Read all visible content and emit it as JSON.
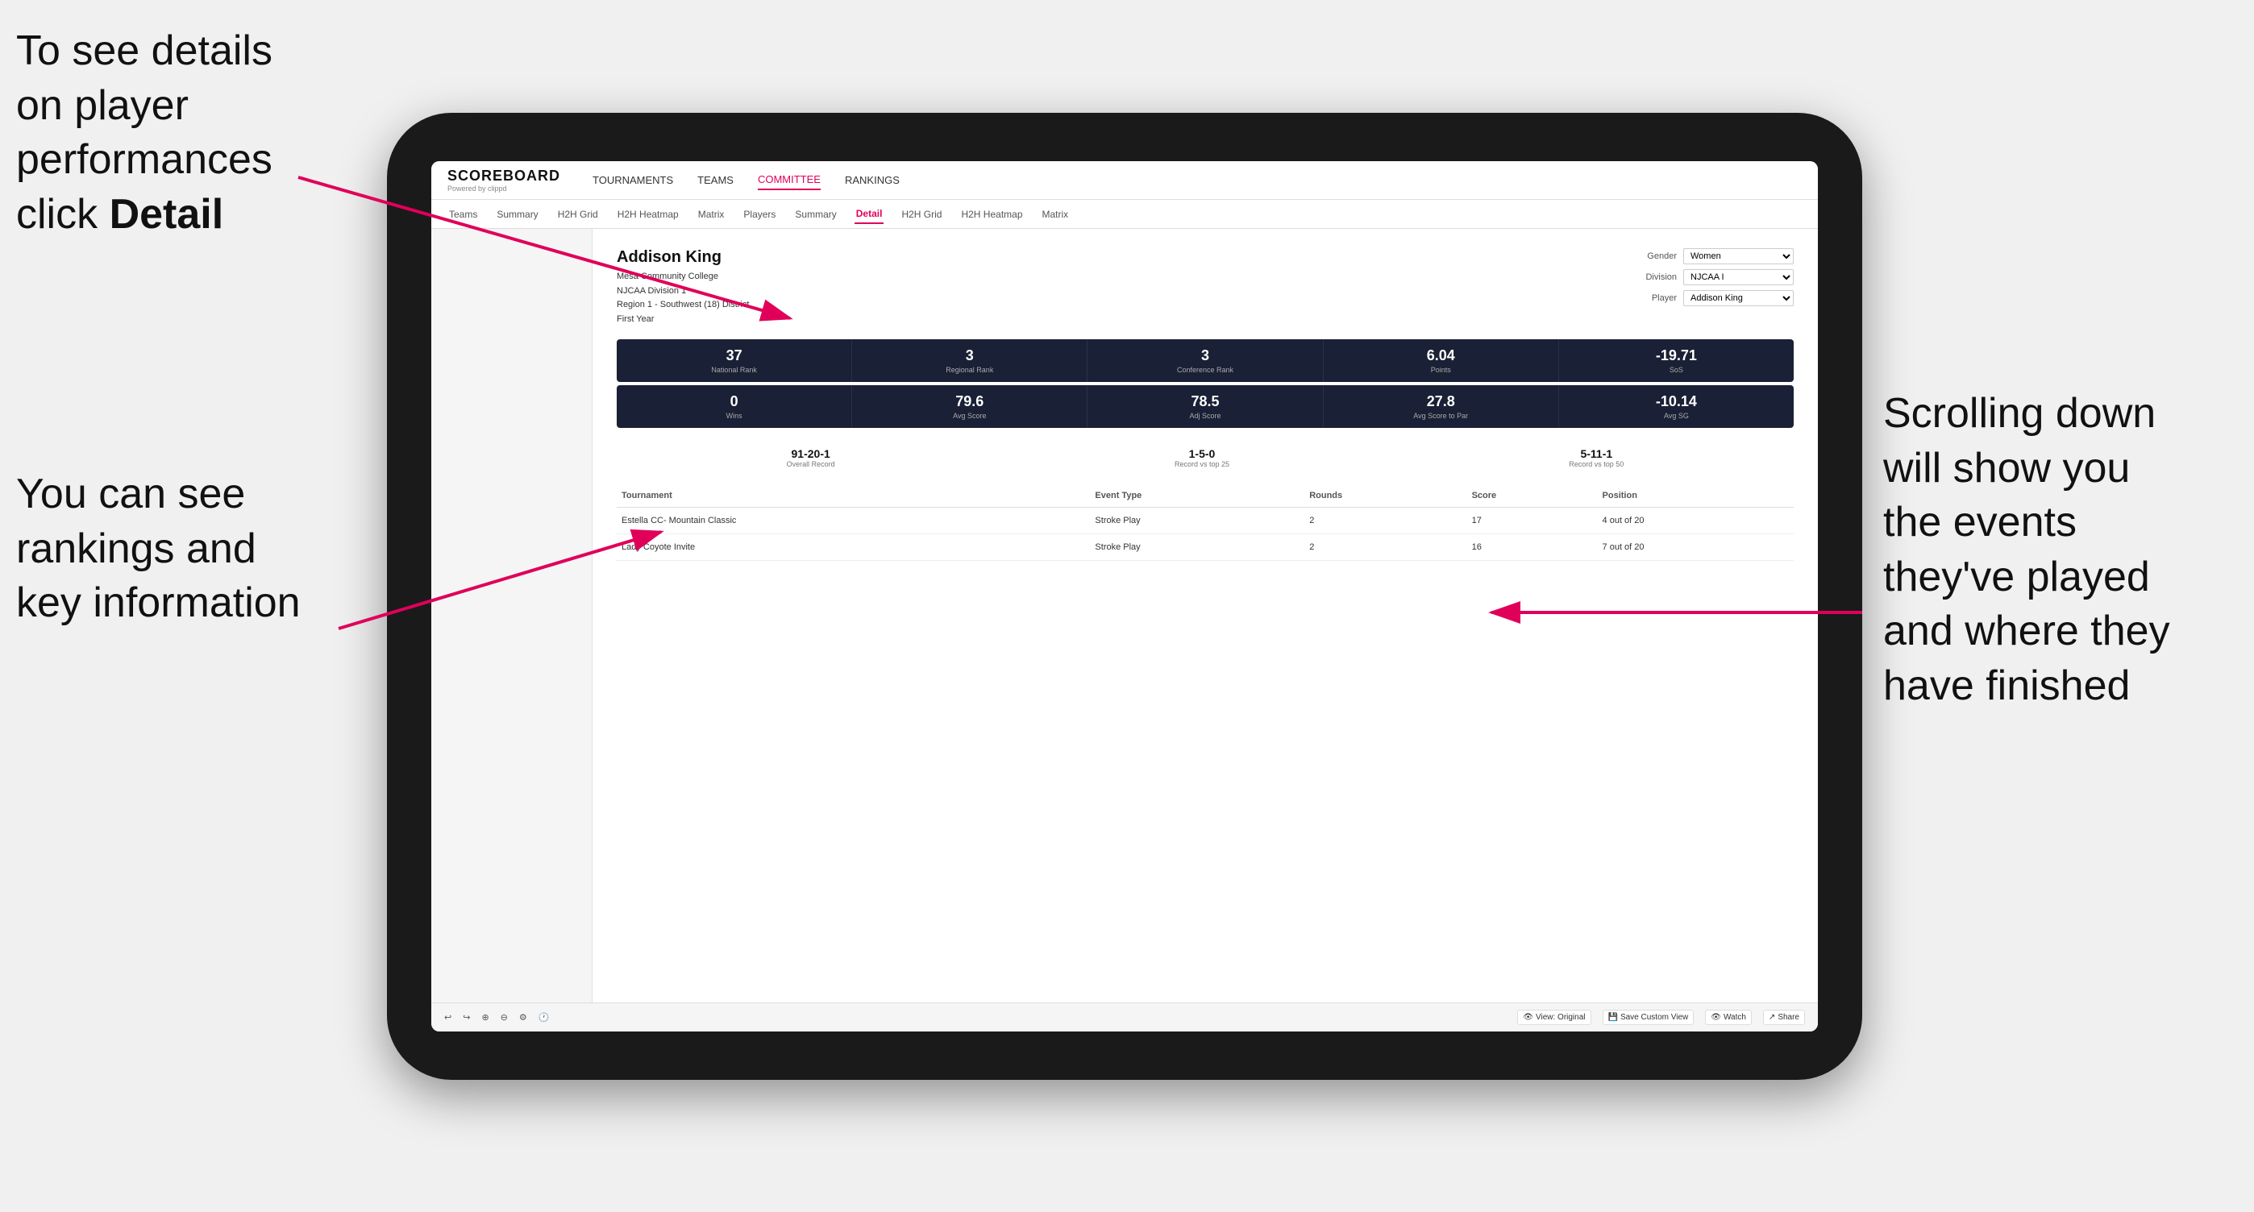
{
  "annotations": {
    "top_left": "To see details on player performances click ",
    "top_left_bold": "Detail",
    "bottom_left_line1": "You can see",
    "bottom_left_line2": "rankings and",
    "bottom_left_line3": "key information",
    "right_line1": "Scrolling down",
    "right_line2": "will show you",
    "right_line3": "the events",
    "right_line4": "they've played",
    "right_line5": "and where they",
    "right_line6": "have finished"
  },
  "nav": {
    "logo_title": "SCOREBOARD",
    "logo_sub": "Powered by clippd",
    "items": [
      "TOURNAMENTS",
      "TEAMS",
      "COMMITTEE",
      "RANKINGS"
    ],
    "active": "COMMITTEE"
  },
  "sub_nav": {
    "items": [
      "Teams",
      "Summary",
      "H2H Grid",
      "H2H Heatmap",
      "Matrix",
      "Players",
      "Summary",
      "Detail",
      "H2H Grid",
      "H2H Heatmap",
      "Matrix"
    ],
    "active": "Detail"
  },
  "player": {
    "name": "Addison King",
    "college": "Mesa Community College",
    "division": "NJCAA Division 1",
    "region": "Region 1 - Southwest (18) District",
    "year": "First Year"
  },
  "controls": {
    "gender_label": "Gender",
    "gender_value": "Women",
    "division_label": "Division",
    "division_value": "NJCAA I",
    "player_label": "Player",
    "player_value": "Addison King"
  },
  "stats_row1": [
    {
      "value": "37",
      "label": "National Rank"
    },
    {
      "value": "3",
      "label": "Regional Rank"
    },
    {
      "value": "3",
      "label": "Conference Rank"
    },
    {
      "value": "6.04",
      "label": "Points"
    },
    {
      "value": "-19.71",
      "label": "SoS"
    }
  ],
  "stats_row2": [
    {
      "value": "0",
      "label": "Wins"
    },
    {
      "value": "79.6",
      "label": "Avg Score"
    },
    {
      "value": "78.5",
      "label": "Adj Score"
    },
    {
      "value": "27.8",
      "label": "Avg Score to Par"
    },
    {
      "value": "-10.14",
      "label": "Avg SG"
    }
  ],
  "records": [
    {
      "value": "91-20-1",
      "label": "Overall Record"
    },
    {
      "value": "1-5-0",
      "label": "Record vs top 25"
    },
    {
      "value": "5-11-1",
      "label": "Record vs top 50"
    }
  ],
  "table": {
    "headers": [
      "Tournament",
      "Event Type",
      "Rounds",
      "Score",
      "Position"
    ],
    "rows": [
      {
        "tournament": "Estella CC- Mountain Classic",
        "event_type": "Stroke Play",
        "rounds": "2",
        "score": "17",
        "position": "4 out of 20"
      },
      {
        "tournament": "Lady Coyote Invite",
        "event_type": "Stroke Play",
        "rounds": "2",
        "score": "16",
        "position": "7 out of 20"
      }
    ]
  },
  "toolbar": {
    "view_original": "View: Original",
    "save_custom": "Save Custom View",
    "watch": "Watch",
    "share": "Share"
  }
}
